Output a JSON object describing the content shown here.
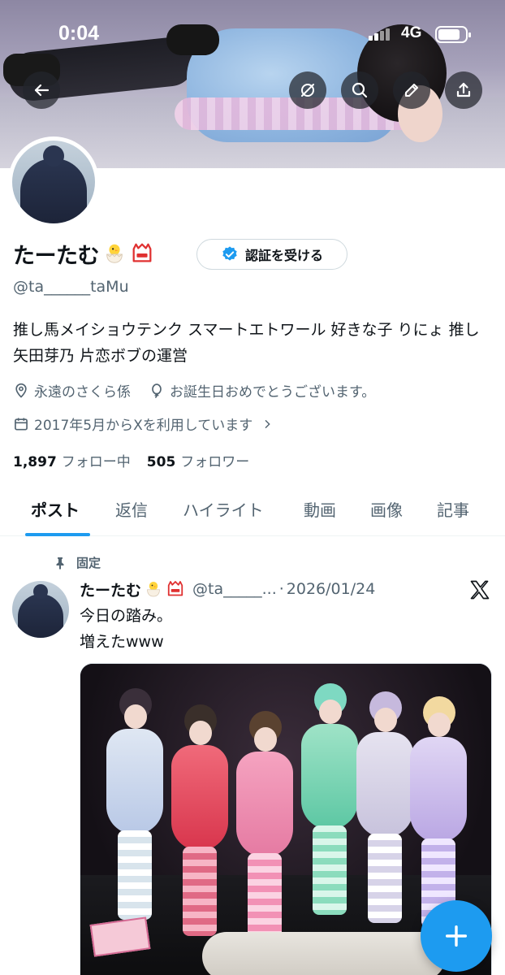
{
  "status_bar": {
    "time": "0:04",
    "network": "4G"
  },
  "profile": {
    "name": "たーたむ",
    "handle": "@ta______taMu",
    "verify_button_label": "認証を受ける",
    "bio": "推し馬メイショウテンク スマートエトワール 好きな子 りにょ 推し 矢田芽乃 片恋ボブの運営",
    "location": "永遠のさくら係",
    "birthday": "お誕生日おめでとうございます。",
    "joined": "2017年5月からXを利用しています",
    "following_count": "1,897",
    "following_label": "フォロー中",
    "followers_count": "505",
    "followers_label": "フォロワー"
  },
  "tabs": [
    {
      "label": "ポスト",
      "active": true
    },
    {
      "label": "返信",
      "active": false
    },
    {
      "label": "ハイライト",
      "active": false
    },
    {
      "label": "動画",
      "active": false
    },
    {
      "label": "画像",
      "active": false
    },
    {
      "label": "記事",
      "active": false
    }
  ],
  "pinned_post": {
    "pinned_label": "固定",
    "author_name": "たーたむ",
    "author_handle": "@ta_____...",
    "separator": "·",
    "date": "2026/01/24",
    "text_line1": "今日の踏み。",
    "text_line2": "増えたwww"
  },
  "colors": {
    "accent": "#1d9bf0",
    "text_primary": "#0f1419",
    "text_secondary": "#536471"
  },
  "icons": [
    "back-arrow-icon",
    "refresh-icon",
    "search-icon",
    "edit-icon",
    "share-icon",
    "verified-icon",
    "location-icon",
    "balloon-icon",
    "calendar-icon",
    "chevron-right-icon",
    "pin-icon",
    "x-logo-icon",
    "plus-icon"
  ]
}
